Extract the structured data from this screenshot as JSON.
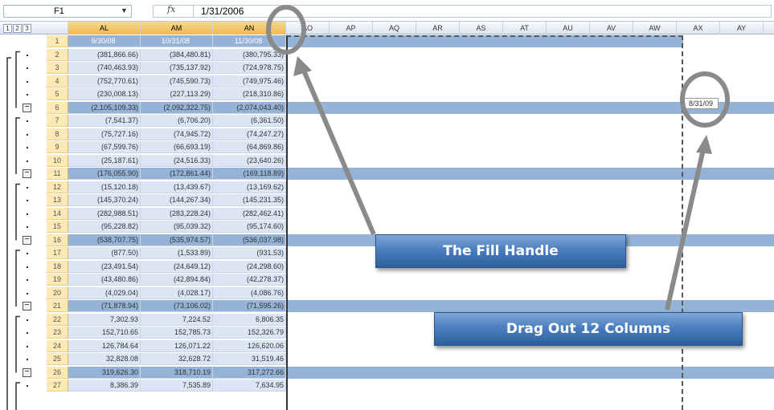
{
  "formula_bar": {
    "cell_ref": "F1",
    "fx_label": "fx",
    "formula": "1/31/2006"
  },
  "outline_levels": [
    "1",
    "2",
    "3"
  ],
  "columns": [
    "AL",
    "AM",
    "AN",
    "AO",
    "AP",
    "AQ",
    "AR",
    "AS",
    "AT",
    "AU",
    "AV",
    "AW",
    "AX",
    "AY"
  ],
  "rows": [
    {
      "n": "1",
      "type": "hdr",
      "v": [
        "9/30/08",
        "10/31/08",
        "11/30/08"
      ]
    },
    {
      "n": "2",
      "type": "data",
      "v": [
        "(381,866.66)",
        "(384,480.81)",
        "(380,795.33)"
      ]
    },
    {
      "n": "3",
      "type": "data",
      "v": [
        "(740,463.93)",
        "(735,137.92)",
        "(724,978.75)"
      ]
    },
    {
      "n": "4",
      "type": "data",
      "v": [
        "(752,770.61)",
        "(745,590.73)",
        "(749,975.46)"
      ]
    },
    {
      "n": "5",
      "type": "data",
      "v": [
        "(230,008.13)",
        "(227,113.29)",
        "(218,310.86)"
      ]
    },
    {
      "n": "6",
      "type": "sub",
      "v": [
        "(2,105,109.33)",
        "(2,092,322.75)",
        "(2,074,043.40)"
      ]
    },
    {
      "n": "7",
      "type": "data",
      "v": [
        "(7,541.37)",
        "(6,706.20)",
        "(6,361.50)"
      ]
    },
    {
      "n": "8",
      "type": "data",
      "v": [
        "(75,727.16)",
        "(74,945.72)",
        "(74,247.27)"
      ]
    },
    {
      "n": "9",
      "type": "data",
      "v": [
        "(67,599.76)",
        "(66,693.19)",
        "(64,869.86)"
      ]
    },
    {
      "n": "10",
      "type": "data",
      "v": [
        "(25,187.61)",
        "(24,516.33)",
        "(23,640.26)"
      ]
    },
    {
      "n": "11",
      "type": "sub",
      "v": [
        "(176,055.90)",
        "(172,861.44)",
        "(169,118.89)"
      ]
    },
    {
      "n": "12",
      "type": "data",
      "v": [
        "(15,120.18)",
        "(13,439.67)",
        "(13,169.62)"
      ]
    },
    {
      "n": "13",
      "type": "data",
      "v": [
        "(145,370.24)",
        "(144,267.34)",
        "(145,231.35)"
      ]
    },
    {
      "n": "14",
      "type": "data",
      "v": [
        "(282,988.51)",
        "(283,228.24)",
        "(282,462.41)"
      ]
    },
    {
      "n": "15",
      "type": "data",
      "v": [
        "(95,228.82)",
        "(95,039.32)",
        "(95,174.60)"
      ]
    },
    {
      "n": "16",
      "type": "sub",
      "v": [
        "(538,707.75)",
        "(535,974.57)",
        "(536,037.98)"
      ]
    },
    {
      "n": "17",
      "type": "data",
      "v": [
        "(877.50)",
        "(1,533.89)",
        "(931.53)"
      ]
    },
    {
      "n": "18",
      "type": "data",
      "v": [
        "(23,491.54)",
        "(24,649.12)",
        "(24,298.60)"
      ]
    },
    {
      "n": "19",
      "type": "data",
      "v": [
        "(43,480.86)",
        "(42,894.84)",
        "(42,278.37)"
      ]
    },
    {
      "n": "20",
      "type": "data",
      "v": [
        "(4,029.04)",
        "(4,028.17)",
        "(4,086.76)"
      ]
    },
    {
      "n": "21",
      "type": "sub",
      "v": [
        "(71,878.94)",
        "(73,106.02)",
        "(71,595.26)"
      ]
    },
    {
      "n": "22",
      "type": "data",
      "v": [
        "7,302.93",
        "7,224.52",
        "6,806.35"
      ]
    },
    {
      "n": "23",
      "type": "data",
      "v": [
        "152,710.65",
        "152,785.73",
        "152,326.79"
      ]
    },
    {
      "n": "24",
      "type": "data",
      "v": [
        "126,784.64",
        "126,071.22",
        "126,620.06"
      ]
    },
    {
      "n": "25",
      "type": "data",
      "v": [
        "32,828.08",
        "32,628.72",
        "31,519.46"
      ]
    },
    {
      "n": "26",
      "type": "sub",
      "v": [
        "319,626.30",
        "318,710.19",
        "317,272.66"
      ]
    },
    {
      "n": "27",
      "type": "data",
      "v": [
        "8,386.39",
        "7,535.89",
        "7,634.95"
      ]
    }
  ],
  "drag_tooltip": "8/31/09",
  "callouts": {
    "fill_handle": "The Fill Handle",
    "drag_out": "Drag Out 12 Columns"
  },
  "colors": {
    "header_blue": "#95b3d7",
    "cell_blue": "#dbe5f3",
    "callout_blue": "#4c7fc0",
    "annotation_gray": "#8a8a8a"
  }
}
